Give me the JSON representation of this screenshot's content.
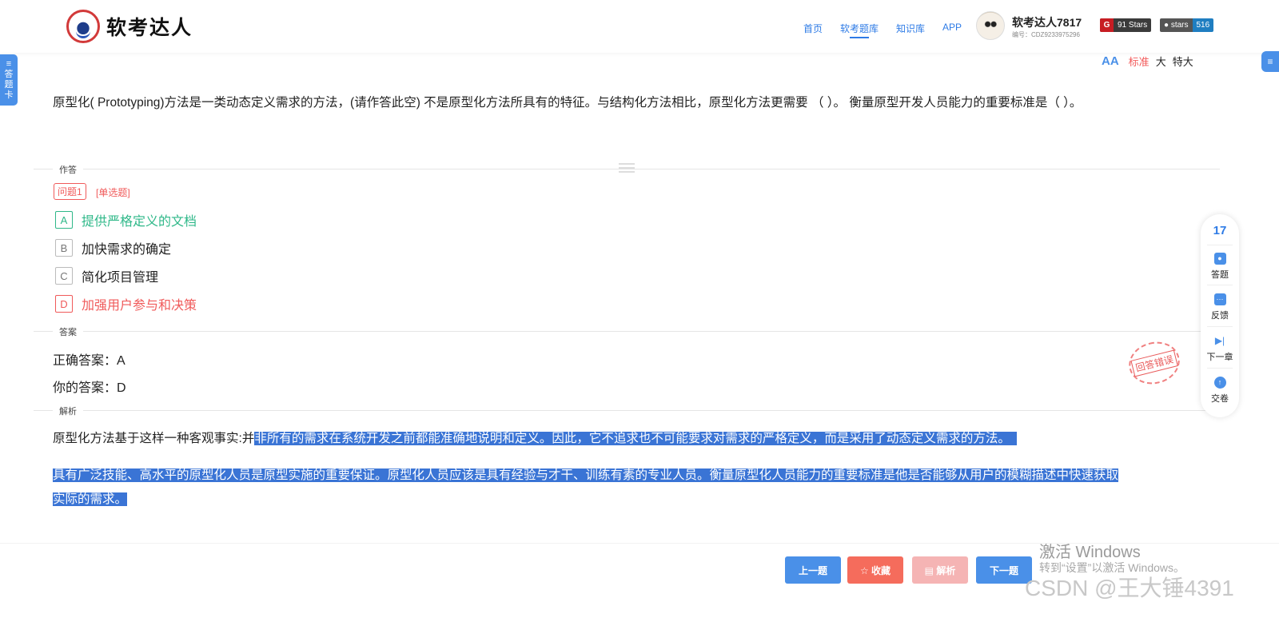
{
  "header": {
    "logo_text": "软考达人",
    "nav": [
      "首页",
      "软考题库",
      "知识库",
      "APP"
    ],
    "active_nav": "软考题库",
    "user_name": "软考达人7817",
    "user_id": "编号：CDZ9233975296",
    "gitee_badge": "91 Stars",
    "github_badge_label": "stars",
    "github_badge_count": "516"
  },
  "side": {
    "left_tab": "答题卡",
    "right_tab_icon": "list-icon"
  },
  "font_size": {
    "options": [
      "标准",
      "大",
      "特大"
    ],
    "active": "标准"
  },
  "question": {
    "text": "原型化( Prototyping)方法是一类动态定义需求的方法，(请作答此空) 不是原型化方法所具有的特征。与结构化方法相比，原型化方法更需要 （ ）。 衡量原型开发人员能力的重要标准是（ ）。"
  },
  "sections": {
    "answer_area": "作答",
    "answer": "答案",
    "analysis": "解析"
  },
  "sub_question": {
    "tag": "问题1",
    "type": "[单选题]"
  },
  "options": [
    {
      "letter": "A",
      "text": "提供严格定义的文档",
      "state": "correct"
    },
    {
      "letter": "B",
      "text": "加快需求的确定",
      "state": "normal"
    },
    {
      "letter": "C",
      "text": "简化项目管理",
      "state": "normal"
    },
    {
      "letter": "D",
      "text": "加强用户参与和决策",
      "state": "wrong"
    }
  ],
  "answer": {
    "correct": "正确答案：A",
    "yours": "你的答案：D"
  },
  "analysis": {
    "p1_plain": "原型化方法基于这样一种客观事实:并",
    "p1_highlight": "非所有的需求在系统开发之前都能准确地说明和定义。因此，它不追求也不可能要求对需求的严格定义，而是采用了动态定义需求的方法。",
    "p2_line1": "具有广泛技能、高水平的原型化人员是原型实施的重要保证。原型化人员应该是具有经验与才干、训练有素的专业人员。衡量原型化人员能力的重要标准是他是否能够从用户的模糊描述中快速获取",
    "p2_line2": "实际的需求。"
  },
  "stamp": "回答错误",
  "toolbar": {
    "count": "17",
    "items": [
      "答题",
      "反馈",
      "下一章",
      "交卷"
    ]
  },
  "buttons": {
    "prev": "上一题",
    "favorite": "☆ 收藏",
    "analysis": "▤ 解析",
    "next": "下一题"
  },
  "watermarks": {
    "win_title": "激活 Windows",
    "win_sub": "转到“设置”以激活 Windows。",
    "csdn": "CSDN @王大锤4391"
  },
  "colors": {
    "primary": "#4a90e8",
    "correct": "#2fb889",
    "wrong": "#f05a5a",
    "highlight": "#3a74d5"
  }
}
